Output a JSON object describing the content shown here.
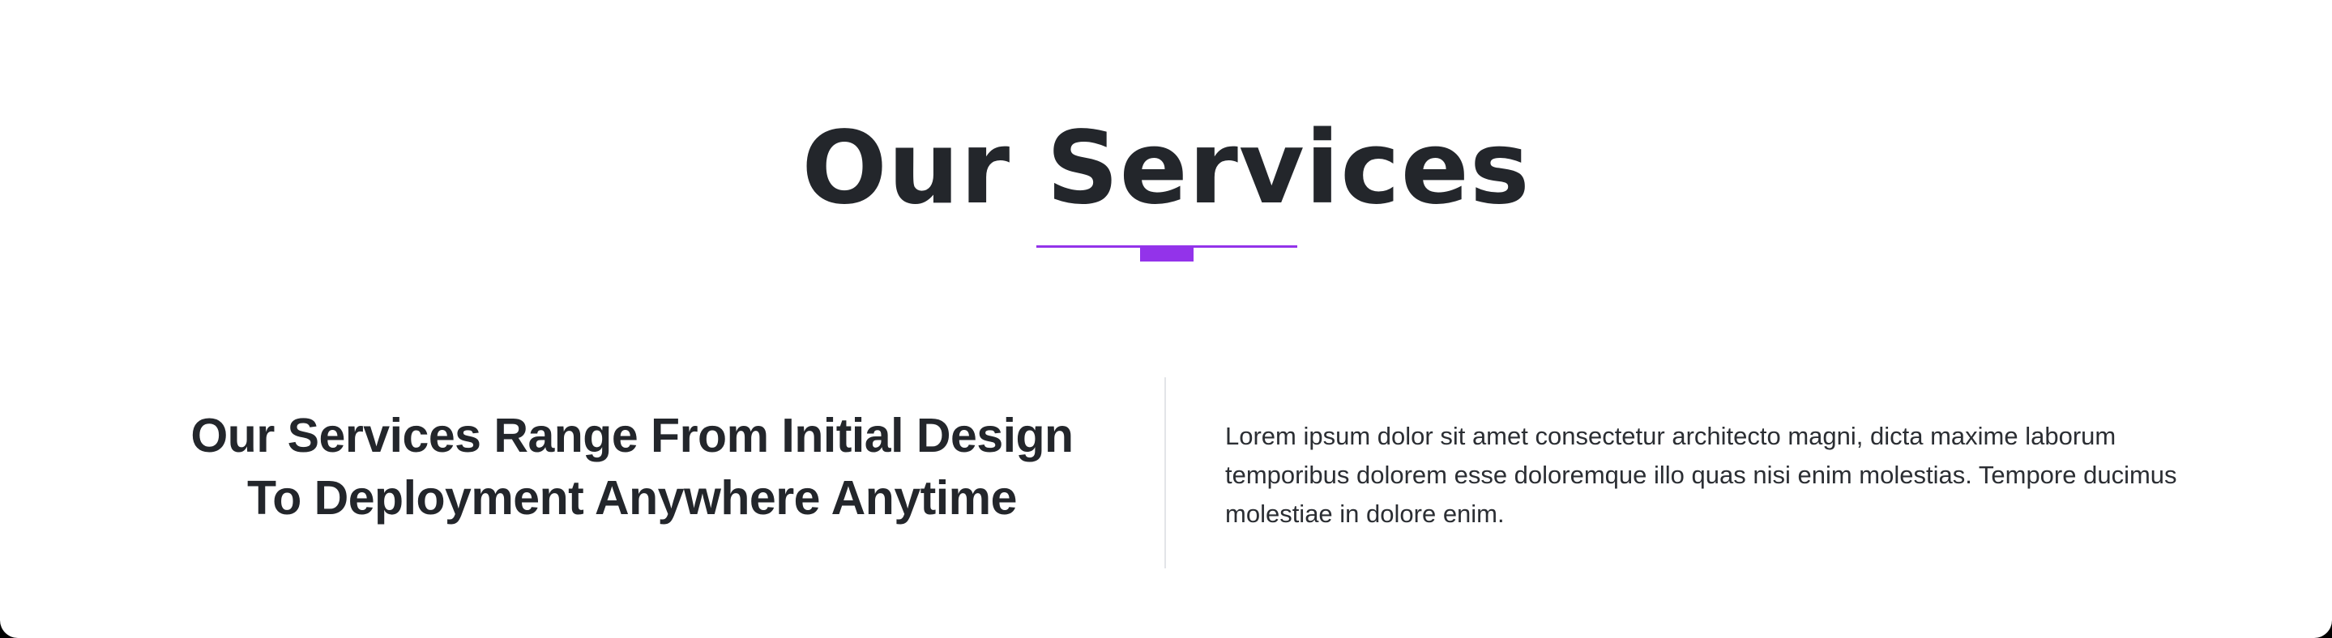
{
  "section": {
    "title": "Our Services",
    "headline_line1": "Our Services Range From Initial Design",
    "headline_line2": "To Deployment Anywhere Anytime",
    "description": "Lorem ipsum dolor sit amet consectetur architecto magni, dicta maxime laborum temporibus dolorem esse doloremque illo quas nisi enim molestias. Tempore ducimus molestiae in dolore enim."
  },
  "colors": {
    "accent": "#9333ea",
    "heading": "#23262b",
    "body_text": "#2b2e33",
    "divider": "#e3e5e8",
    "background": "#ffffff"
  }
}
